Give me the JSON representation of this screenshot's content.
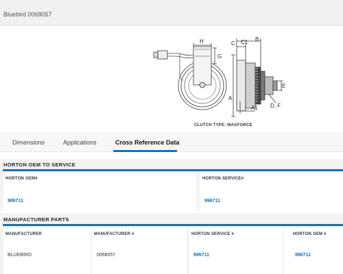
{
  "page": {
    "title": "Bluebird 0068057"
  },
  "diagram": {
    "caption": "CLUTCH TYPE: MAGFORCE",
    "labels": {
      "H": "H",
      "G": "G",
      "C": "C",
      "C1": "C1",
      "B": "B",
      "A": "A",
      "A1": "A1",
      "DF": "D, F",
      "E": "E"
    }
  },
  "tabs": [
    {
      "label": "Dimensions",
      "active": false
    },
    {
      "label": "Applications",
      "active": false
    },
    {
      "label": "Cross Reference Data",
      "active": true
    }
  ],
  "oem_to_service": {
    "title": "HORTON OEM TO SERVICE",
    "headers": [
      "HORTON OEM#",
      "HORTON SERVICE#"
    ],
    "rows": [
      [
        "986711",
        "996711"
      ]
    ]
  },
  "manufacturer_parts": {
    "title": "MANUFACTURER PARTS",
    "headers": [
      "MANUFACTURER",
      "MANUFACTURER #",
      "HORTON SERVICE #",
      "HORTON OEM #"
    ],
    "rows": [
      [
        "BLUEBIRD",
        "0068057",
        "996711",
        "986711"
      ]
    ]
  },
  "colors": {
    "accent": "#1a6fb0",
    "band": "#f3f3f3"
  }
}
